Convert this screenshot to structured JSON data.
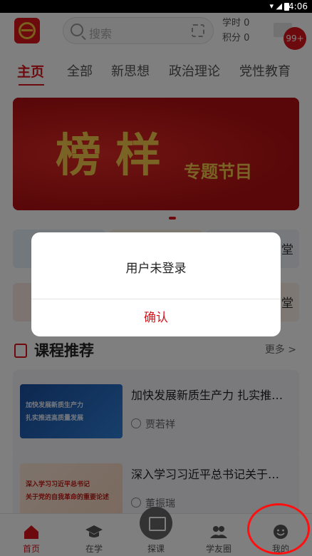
{
  "statusbar": {
    "time": "4:06"
  },
  "header": {
    "search_placeholder": "搜索",
    "study_hours_label": "学时 0",
    "points_label": "积分 0",
    "badge_count": "99+"
  },
  "tabs": [
    "主页",
    "全部",
    "新思想",
    "政治理论",
    "党性教育"
  ],
  "banner": {
    "title": "榜样",
    "subtitle": "专题节目"
  },
  "quick_cards": {
    "right_text_1": "堂",
    "right_text_2": "堂"
  },
  "section": {
    "title": "课程推荐",
    "more": "更多 >"
  },
  "courses": [
    {
      "title": "加快发展新质生产力 扎实推…",
      "author": "贾若祥",
      "thumb_line1": "加快发展新质生产力",
      "thumb_line2": "扎实推进高质量发展"
    },
    {
      "title": "深入学习习近平总书记关于…",
      "author": "董振瑞",
      "thumb_line1": "深入学习习近平总书记",
      "thumb_line2": "关于党的自我革命的重要论述"
    }
  ],
  "bottom_nav": [
    {
      "label": "首页",
      "icon": "home-icon"
    },
    {
      "label": "在学",
      "icon": "graduation-cap-icon"
    },
    {
      "label": "探课",
      "icon": "book-icon"
    },
    {
      "label": "学友圈",
      "icon": "people-icon"
    },
    {
      "label": "我的",
      "icon": "smiley-icon"
    }
  ],
  "dialog": {
    "message": "用户未登录",
    "confirm_label": "确认"
  },
  "colors": {
    "accent": "#d9141a",
    "annotation": "#ff1010"
  }
}
